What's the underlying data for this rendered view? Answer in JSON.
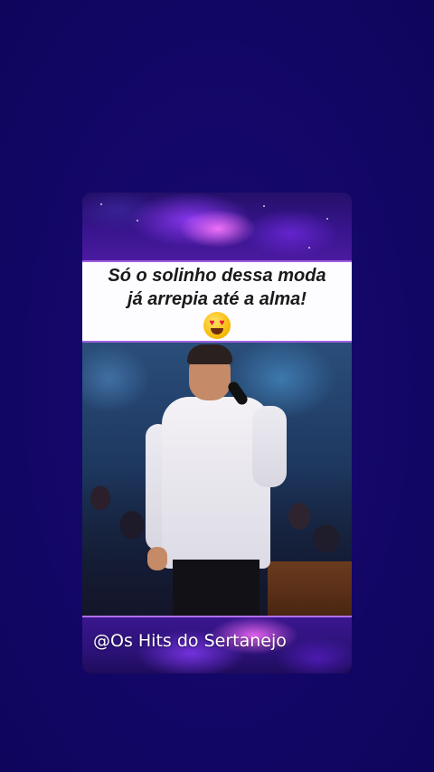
{
  "caption": {
    "line1": "Só o solinho dessa moda",
    "line2": "já arrepia até a alma!",
    "emoji": "smiling-face-with-heart-eyes"
  },
  "watermark": {
    "text": "@Os Hits do Sertanejo"
  },
  "colors": {
    "background": "#14076a",
    "accent_border": "#a060e0",
    "caption_bg": "#fdfcff"
  }
}
